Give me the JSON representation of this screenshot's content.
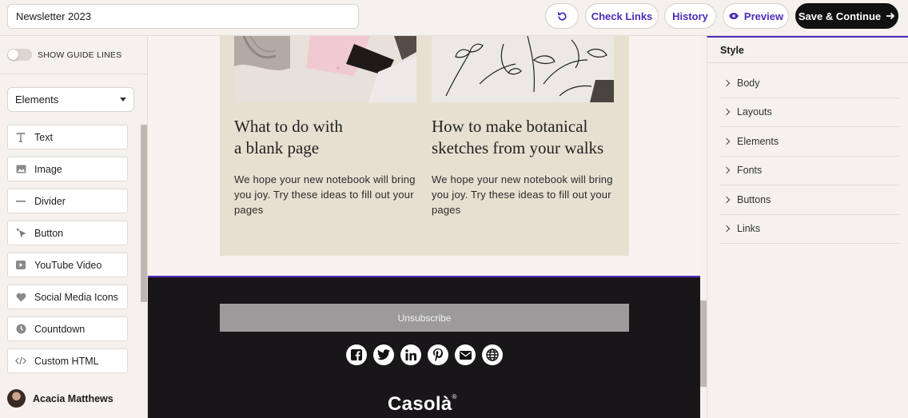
{
  "topbar": {
    "title_value": "Newsletter 2023",
    "undo_icon": "undo-icon",
    "check_links_label": "Check Links",
    "history_label": "History",
    "preview_label": "Preview",
    "save_label": "Save & Continue",
    "accent_color": "#4b2dba"
  },
  "sidebar": {
    "guide_label": "SHOW GUIDE LINES",
    "select_value": "Elements",
    "items": [
      {
        "label": "Text",
        "icon": "text-icon"
      },
      {
        "label": "Image",
        "icon": "image-icon"
      },
      {
        "label": "Divider",
        "icon": "divider-icon"
      },
      {
        "label": "Button",
        "icon": "cursor-icon"
      },
      {
        "label": "YouTube Video",
        "icon": "play-icon"
      },
      {
        "label": "Social Media Icons",
        "icon": "heart-icon"
      },
      {
        "label": "Countdown",
        "icon": "clock-icon"
      },
      {
        "label": "Custom HTML",
        "icon": "code-icon"
      }
    ],
    "user_name": "Acacia Matthews"
  },
  "canvas": {
    "articles": [
      {
        "title_line1": "What to do with",
        "title_line2": "a blank page",
        "body": "We hope your new notebook will bring you joy. Try these ideas to fill out your pages"
      },
      {
        "title_line1": "How to make botanical",
        "title_line2": "sketches from your walks",
        "body": "We hope your new notebook will bring you joy. Try these ideas to fill out your pages"
      }
    ],
    "unsubscribe_label": "Unsubscribe",
    "socials": [
      "facebook-icon",
      "twitter-icon",
      "linkedin-icon",
      "pinterest-icon",
      "email-icon",
      "globe-icon"
    ],
    "brand": "Casolà",
    "brand_mark": "®"
  },
  "style_panel": {
    "title": "Style",
    "items": [
      "Body",
      "Layouts",
      "Elements",
      "Fonts",
      "Buttons",
      "Links"
    ]
  }
}
